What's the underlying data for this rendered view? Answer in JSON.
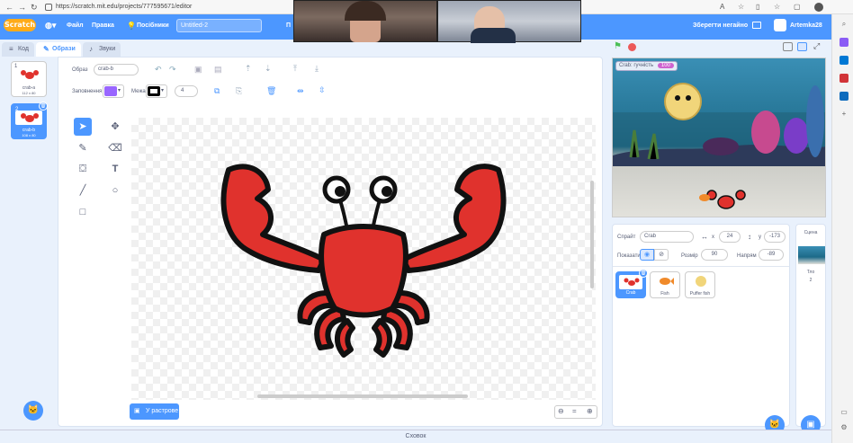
{
  "browser": {
    "url": "https://scratch.mit.edu/projects/777595671/editor",
    "back": "←",
    "forward": "→",
    "reload": "↻"
  },
  "menubar": {
    "logo": "Scratch",
    "file": "Файл",
    "edit": "Правка",
    "tutorials": "Посібники",
    "title": "Untitled-2",
    "share_partial": "П",
    "see_project": "Зберегти негайно",
    "user": "Artemka28"
  },
  "tabs": {
    "code": "Код",
    "costumes": "Образи",
    "sounds": "Звуки"
  },
  "costumes": [
    {
      "index": "1",
      "name": "crab-a",
      "size": "112 x 80"
    },
    {
      "index": "2",
      "name": "crab-b",
      "size": "108 x 80"
    }
  ],
  "editor": {
    "costume_label": "Образ",
    "costume_name": "crab-b",
    "fill_label": "Заповнення",
    "outline_label": "Межа",
    "outline_width": "4",
    "convert_button": "У растрове",
    "fill_color": "#9966ff",
    "outline_color": "#000000"
  },
  "stage": {
    "monitor_label": "Crab: гучність",
    "monitor_value": "100"
  },
  "sprite_info": {
    "sprite_label": "Спрайт",
    "sprite_name": "Crab",
    "x_label": "x",
    "x_value": "24",
    "y_label": "y",
    "y_value": "-173",
    "show_label": "Показати",
    "size_label": "Розмір",
    "size_value": "90",
    "direction_label": "Напрям",
    "direction_value": "-89"
  },
  "sprites": [
    {
      "name": "Crab"
    },
    {
      "name": "Fish"
    },
    {
      "name": "Puffer fish"
    }
  ],
  "stage_panel": {
    "title": "Сцена",
    "backdrops_label": "Тло",
    "backdrops_count": "2"
  },
  "backpack": "Сховок"
}
